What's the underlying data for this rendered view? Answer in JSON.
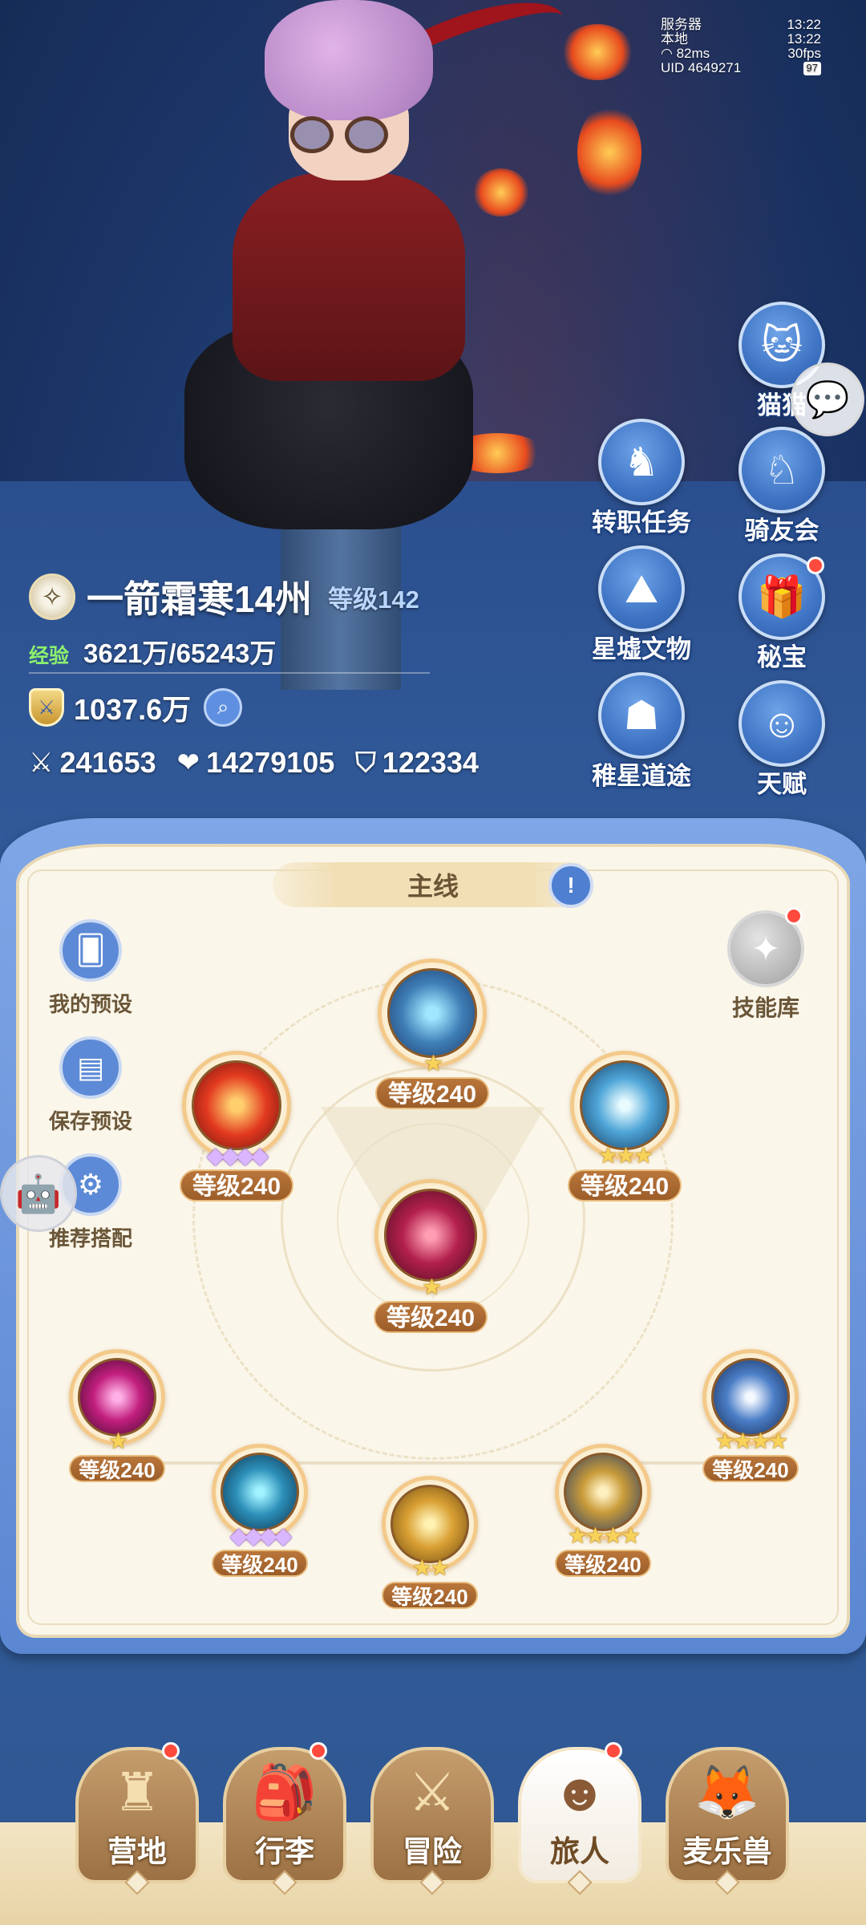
{
  "status": {
    "server_label": "服务器",
    "server_time": "13:22",
    "local_label": "本地",
    "local_time": "13:22",
    "ping": "82ms",
    "fps": "30fps",
    "uid": "UID 4649271",
    "battery": "97"
  },
  "side_buttons": {
    "cat": "猫猫",
    "job_quest": "转职任务",
    "rider_club": "骑友会",
    "ruins_relics": "星墟文物",
    "treasure": "秘宝",
    "star_path": "稚星道途",
    "talent": "天赋"
  },
  "player": {
    "name": "一箭霜寒14州",
    "level": "等级142",
    "exp_label": "经验",
    "exp_value": "3621万/65243万",
    "power": "1037.6万",
    "attack": "241653",
    "hp": "14279105",
    "defense": "122334"
  },
  "panel": {
    "tab_title": "主线",
    "info_icon": "!",
    "presets": "我的预设",
    "save_preset": "保存预设",
    "recommend": "推荐搭配",
    "skill_library": "技能库"
  },
  "skills": [
    {
      "id": "top",
      "level": "等级240",
      "stars": "★",
      "star_type": "gold"
    },
    {
      "id": "upper-left",
      "level": "等级240",
      "stars": "◆◆◆◆",
      "star_type": "purple"
    },
    {
      "id": "upper-right",
      "level": "等级240",
      "stars": "★★★",
      "star_type": "gold"
    },
    {
      "id": "center",
      "level": "等级240",
      "stars": "★",
      "star_type": "gold"
    },
    {
      "id": "lower-far-left",
      "level": "等级240",
      "stars": "★",
      "star_type": "gold"
    },
    {
      "id": "lower-left",
      "level": "等级240",
      "stars": "◆◆◆◆",
      "star_type": "purple"
    },
    {
      "id": "lower-middle",
      "level": "等级240",
      "stars": "★★",
      "star_type": "gold"
    },
    {
      "id": "lower-right",
      "level": "等级240",
      "stars": "★★★★",
      "star_type": "gold"
    },
    {
      "id": "lower-far-right",
      "level": "等级240",
      "stars": "★★★★",
      "star_type": "gold"
    }
  ],
  "nav": {
    "camp": "营地",
    "luggage": "行李",
    "adventure": "冒险",
    "traveler": "旅人",
    "pets": "麦乐兽"
  },
  "colors": {
    "panel_bg": "#fbf6ea",
    "frame_blue": "#5b87d2",
    "level_badge": "#9c5d29",
    "red_dot": "#ff4a3d"
  }
}
